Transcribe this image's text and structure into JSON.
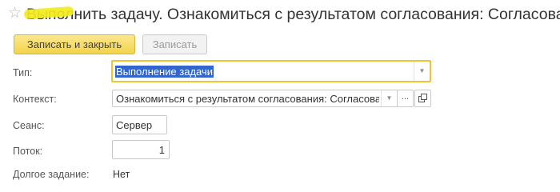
{
  "window": {
    "title": "Выполнить задачу. Ознакомиться с результатом согласования: Согласован…",
    "favorite_icon": "star-icon"
  },
  "toolbar": {
    "save_close_label": "Записать и закрыть",
    "save_label": "Записать"
  },
  "form": {
    "type": {
      "label": "Тип:",
      "value": "Выполнение задачи",
      "icon": "chevron-down-icon"
    },
    "context": {
      "label": "Контекст:",
      "value": "Ознакомиться с результатом согласования: Согласовано",
      "dropdown_icon": "chevron-down-icon",
      "select_label": "...",
      "open_icon": "open-window-icon"
    },
    "session": {
      "label": "Сеанс:",
      "value": "Сервер"
    },
    "thread": {
      "label": "Поток:",
      "value": "1"
    },
    "long_task": {
      "label": "Долгое задание:",
      "value": "Нет"
    }
  },
  "colors": {
    "primary_button": "#f3d34b",
    "focus_border": "#f1c232",
    "selection": "#3366cc",
    "marker": "#f3ea1c"
  }
}
